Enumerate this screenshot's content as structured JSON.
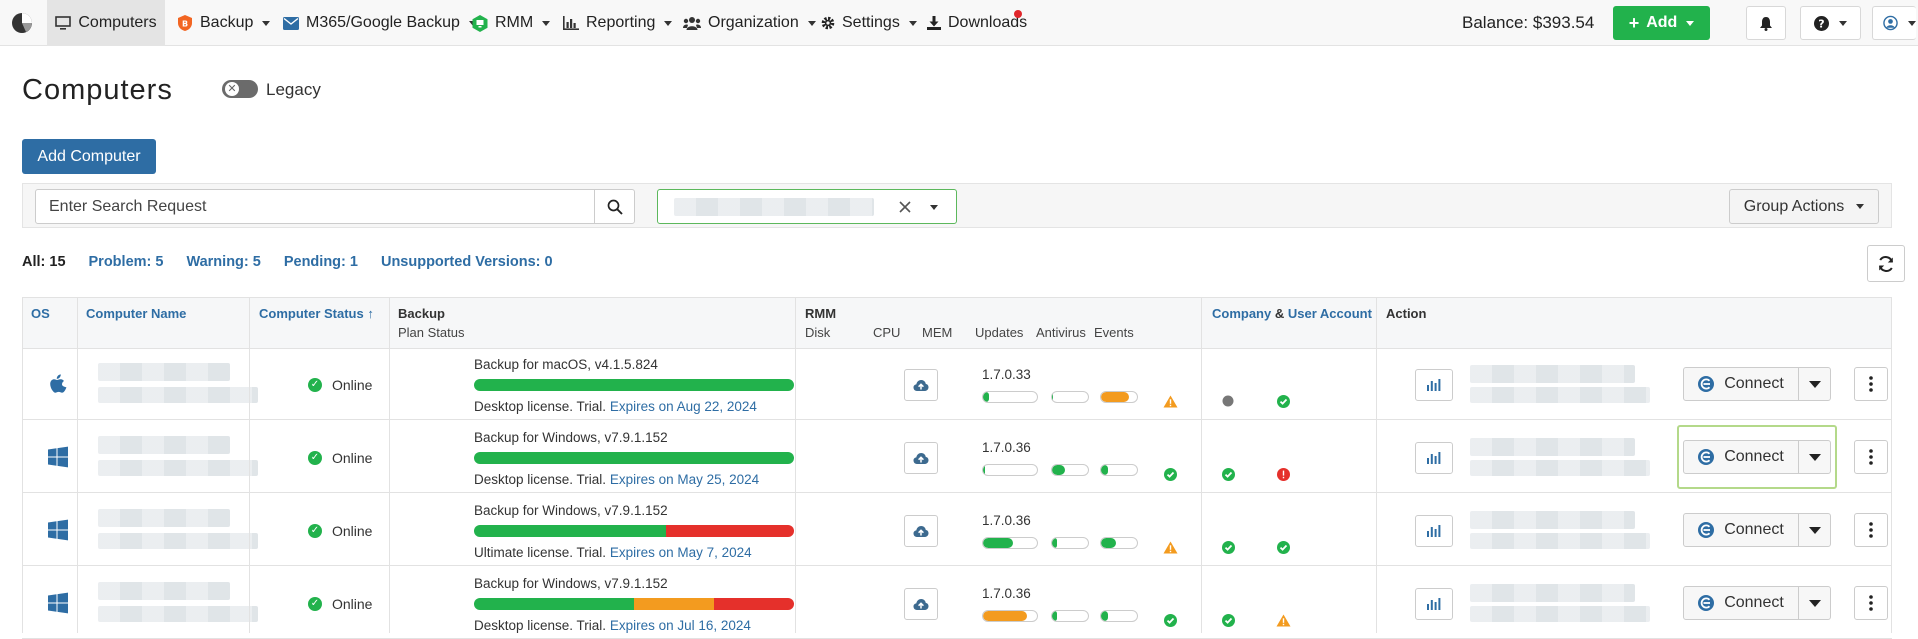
{
  "nav": {
    "items": [
      {
        "label": "Computers",
        "icon": "monitor-icon",
        "active": true
      },
      {
        "label": "Backup",
        "icon": "backup-shield-icon"
      },
      {
        "label": "M365/Google Backup",
        "icon": "envelope-icon"
      },
      {
        "label": "RMM",
        "icon": "rmm-icon"
      },
      {
        "label": "Reporting",
        "icon": "bar-chart-icon"
      },
      {
        "label": "Organization",
        "icon": "users-icon"
      },
      {
        "label": "Settings",
        "icon": "gear-icon"
      },
      {
        "label": "Downloads",
        "icon": "download-icon"
      }
    ],
    "balance": "Balance: $393.54",
    "add_label": "Add"
  },
  "page": {
    "title": "Computers",
    "legacy_label": "Legacy",
    "add_computer_label": "Add Computer"
  },
  "filter": {
    "search_placeholder": "Enter Search Request",
    "group_actions_label": "Group Actions"
  },
  "counts": {
    "all": "All: 15",
    "problem": "Problem: 5",
    "warning": "Warning: 5",
    "pending": "Pending: 1",
    "unsupported": "Unsupported Versions: 0"
  },
  "table": {
    "headers": {
      "os": "OS",
      "name": "Computer Name",
      "status": "Computer Status",
      "backup": "Backup",
      "plan_status": "Plan Status",
      "rmm": "RMM",
      "disk": "Disk",
      "cpu": "CPU",
      "mem": "MEM",
      "updates": "Updates",
      "antivirus": "Antivirus",
      "events": "Events",
      "company": "Company",
      "amp": "&",
      "user_account": "User Account",
      "action": "Action"
    },
    "sort_indicator": "↑",
    "connect_label": "Connect",
    "rows": [
      {
        "os": "apple",
        "status": "Online",
        "plan": "Backup for macOS, v4.1.5.824",
        "plan_bar": [
          {
            "frac": 1.0,
            "color": "#22b24c"
          }
        ],
        "license": "Desktop license. Trial.",
        "expires": "Expires on Aug 22, 2024",
        "rmm_version": "1.7.0.33",
        "disk": 0.12,
        "cpu": 0.03,
        "mem": 0.78,
        "updates": "warning",
        "antivirus": "unknown",
        "events": "ok"
      },
      {
        "os": "windows",
        "status": "Online",
        "plan": "Backup for Windows, v7.9.1.152",
        "plan_bar": [
          {
            "frac": 1.0,
            "color": "#22b24c"
          }
        ],
        "license": "Desktop license. Trial.",
        "expires": "Expires on May 25, 2024",
        "rmm_version": "1.7.0.36",
        "disk": 0.02,
        "cpu": 0.35,
        "mem": 0.2,
        "updates": "ok",
        "antivirus": "ok",
        "events": "error",
        "highlighted": true
      },
      {
        "os": "windows",
        "status": "Online",
        "plan": "Backup for Windows, v7.9.1.152",
        "plan_bar": [
          {
            "frac": 0.6,
            "color": "#22b24c"
          },
          {
            "frac": 0.4,
            "color": "#e5302b"
          }
        ],
        "license": "Ultimate license. Trial.",
        "expires": "Expires on May 7, 2024",
        "rmm_version": "1.7.0.36",
        "disk": 0.55,
        "cpu": 0.15,
        "mem": 0.42,
        "updates": "warning",
        "antivirus": "ok",
        "events": "ok"
      },
      {
        "os": "windows",
        "status": "Online",
        "plan": "Backup for Windows, v7.9.1.152",
        "plan_bar": [
          {
            "frac": 0.5,
            "color": "#22b24c"
          },
          {
            "frac": 0.25,
            "color": "#f39b1f"
          },
          {
            "frac": 0.25,
            "color": "#e5302b"
          }
        ],
        "license": "Desktop license. Trial.",
        "expires": "Expires on Jul 16, 2024",
        "rmm_version": "1.7.0.36",
        "disk": 0.82,
        "cpu": 0.15,
        "mem": 0.2,
        "updates": "ok",
        "antivirus": "ok",
        "events": "warning"
      }
    ]
  }
}
